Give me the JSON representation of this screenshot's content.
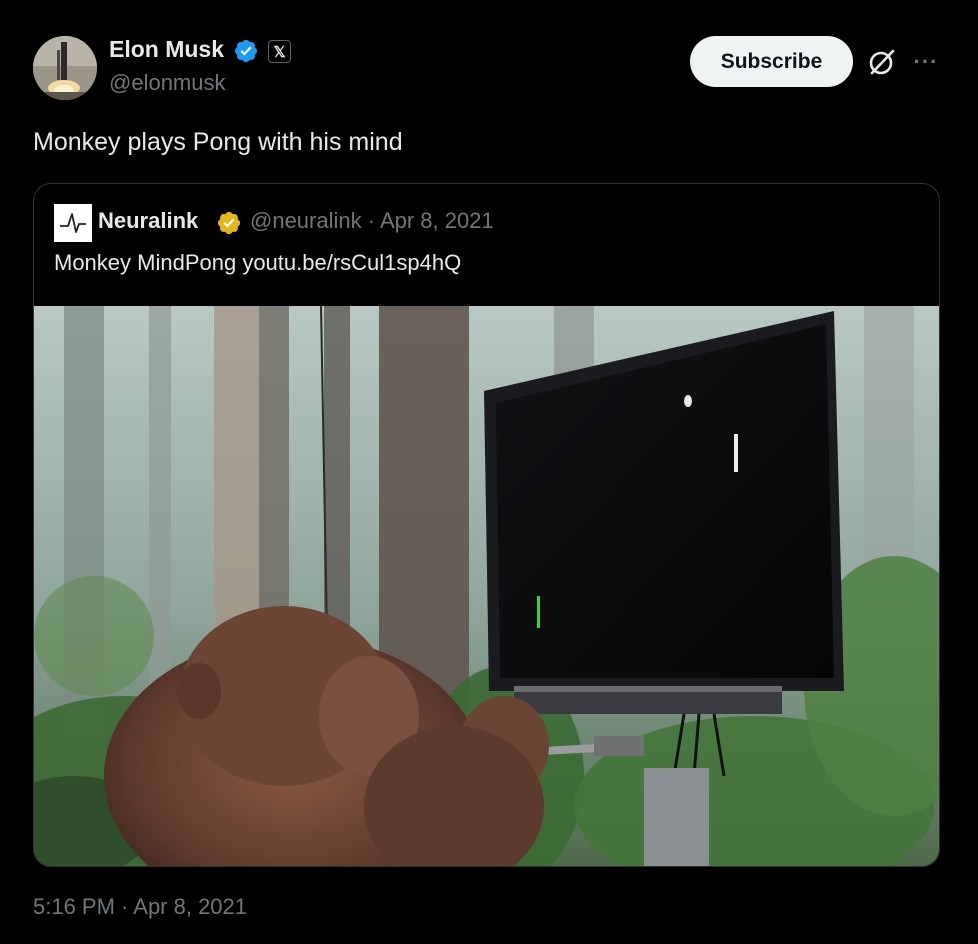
{
  "author": {
    "name": "Elon Musk",
    "handle": "@elonmusk",
    "x_badge": "𝕏"
  },
  "actions": {
    "subscribe_label": "Subscribe",
    "more_label": "···"
  },
  "tweet": {
    "text": "Monkey plays Pong with his mind",
    "timestamp": "5:16 PM · Apr 8, 2021"
  },
  "quote": {
    "name": "Neuralink",
    "handle_date": "@neuralink · Apr 8, 2021",
    "text": "Monkey MindPong youtu.be/rsCul1sp4hQ"
  },
  "colors": {
    "verified_blue": "#1d9bf0",
    "verified_gold": "#e2b719",
    "secondary_text": "#71767b"
  },
  "icons": [
    "verified-badge-icon",
    "x-logo-icon",
    "grok-icon",
    "more-icon",
    "neuralink-logo-icon"
  ]
}
